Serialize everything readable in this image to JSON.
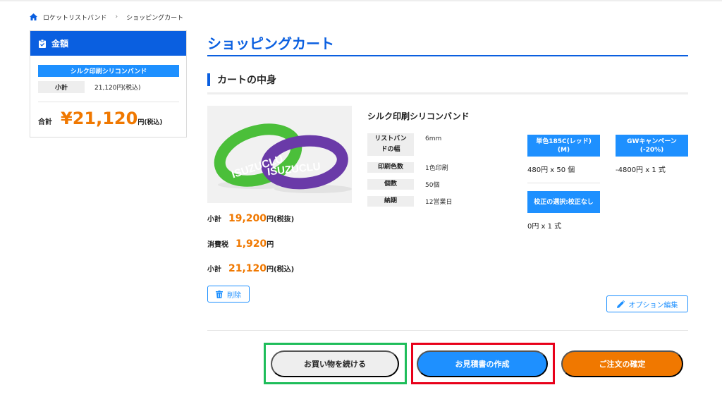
{
  "breadcrumb": {
    "items": [
      "ロケットリストバンド",
      "ショッピングカート"
    ],
    "separator": "›"
  },
  "sidebar": {
    "title": "金額",
    "product_name": "シルク印刷シリコンバンド",
    "subtotal_label": "小計",
    "subtotal_value": "21,120円(税込)",
    "total_label": "合計",
    "total_amount": "¥21,120",
    "total_suffix": "円(税込)"
  },
  "main": {
    "title": "ショッピングカート",
    "section_title": "カートの中身"
  },
  "product": {
    "name": "シルク印刷シリコンバンド",
    "image_text": "ISUZUCLU",
    "specs": [
      {
        "label": "リストバンドの幅",
        "value": "6mm"
      },
      {
        "label": "印刷色数",
        "value": "1色印刷"
      },
      {
        "label": "個数",
        "value": "50個"
      },
      {
        "label": "納期",
        "value": "12営業日"
      }
    ],
    "options": [
      {
        "label": "単色185C(レッド)(M)",
        "value": "480円 x 50 個"
      },
      {
        "label": "GWキャンペーン(-20%)",
        "value": "-4800円 x 1 式"
      },
      {
        "label": "校正の選択:校正なし",
        "value": "0円 x 1 式"
      }
    ],
    "prices": {
      "subtotal_label": "小計",
      "subtotal_amount": "19,200",
      "subtotal_suffix": "円(税抜)",
      "tax_label": "消費税",
      "tax_amount": "1,920",
      "tax_suffix": "円",
      "total_label": "小計",
      "total_amount": "21,120",
      "total_suffix": "円(税込)"
    },
    "delete_label": "削除",
    "edit_label": "オプション編集"
  },
  "actions": {
    "continue_label": "お買い物を続ける",
    "quote_label": "お見積書の作成",
    "order_label": "ご注文の確定"
  },
  "colors": {
    "primary_blue": "#0a5fe0",
    "accent_blue": "#1e90ff",
    "accent_orange": "#f07800",
    "highlight_green": "#1ebd5a",
    "highlight_red": "#e8001a"
  }
}
